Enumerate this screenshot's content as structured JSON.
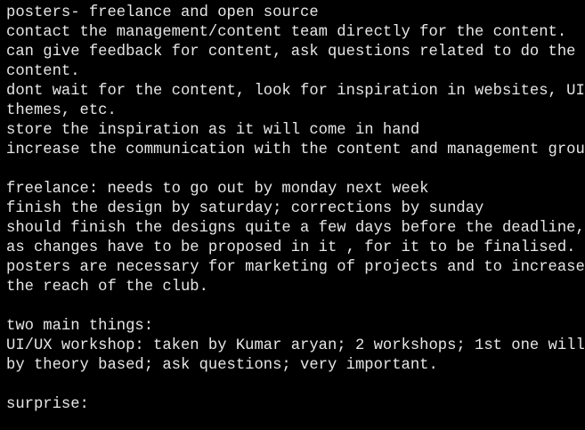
{
  "text_color": "#e6e6e6",
  "background_color": "#000000",
  "lines": [
    "posters- freelance and open source",
    "contact the management/content team directly for the content.",
    "can give feedback for content, ask questions related to do the",
    "content.",
    "dont wait for the content, look for inspiration in websites, UI,",
    "themes, etc.",
    "store the inspiration as it will come in hand",
    "increase the communication with the content and management group.",
    "",
    "freelance: needs to go out by monday next week",
    "finish the design by saturday; corrections by sunday",
    "should finish the designs quite a few days before the deadline,",
    "as changes have to be proposed in it , for it to be finalised.",
    "posters are necessary for marketing of projects and to increase",
    "the reach of the club.",
    "",
    "two main things:",
    "UI/UX workshop: taken by Kumar aryan; 2 workshops; 1st one will",
    "by theory based; ask questions; very important.",
    "",
    "surprise:"
  ]
}
